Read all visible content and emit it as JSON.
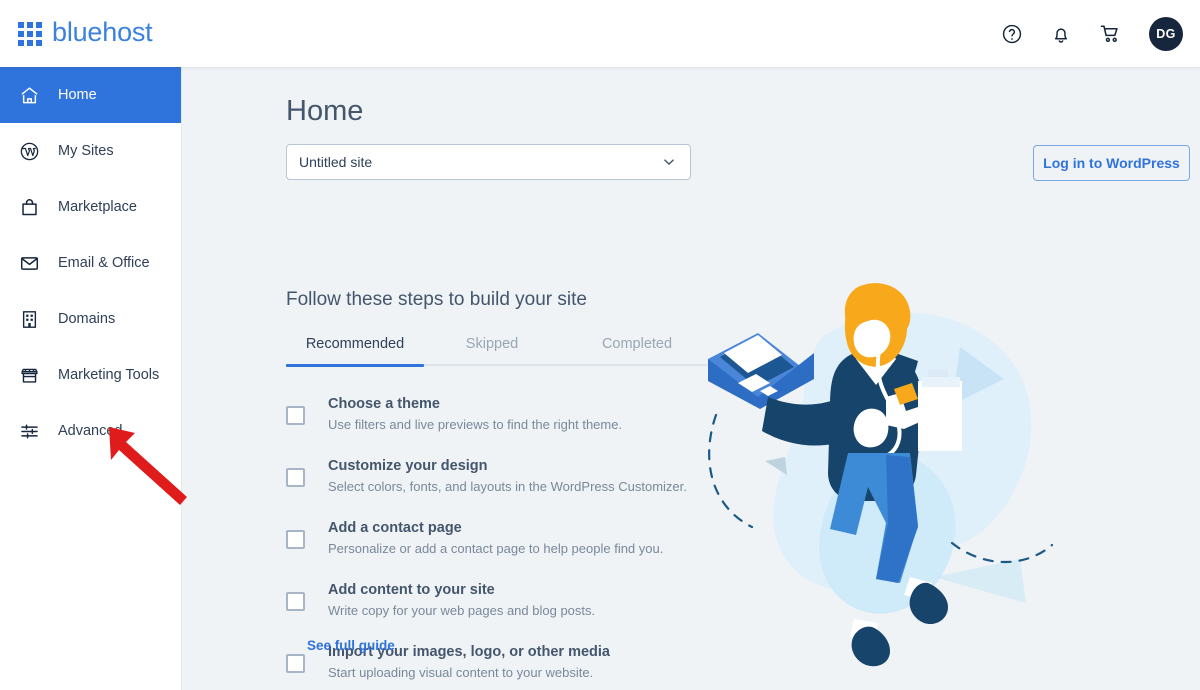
{
  "header": {
    "brand_name": "bluehost",
    "logo_icon": "grid-apps-icon",
    "actions": [
      {
        "name": "help-icon",
        "label": "Help"
      },
      {
        "name": "notifications-icon",
        "label": "Notifications"
      },
      {
        "name": "cart-icon",
        "label": "Cart"
      }
    ],
    "avatar_initials": "DG"
  },
  "sidebar": {
    "items": [
      {
        "label": "Home",
        "icon": "home-icon",
        "active": true
      },
      {
        "label": "My Sites",
        "icon": "wordpress-icon",
        "active": false
      },
      {
        "label": "Marketplace",
        "icon": "shopping-bag-icon",
        "active": false
      },
      {
        "label": "Email & Office",
        "icon": "envelope-icon",
        "active": false
      },
      {
        "label": "Domains",
        "icon": "building-icon",
        "active": false
      },
      {
        "label": "Marketing Tools",
        "icon": "storefront-icon",
        "active": false
      },
      {
        "label": "Advanced",
        "icon": "sliders-icon",
        "active": false
      }
    ]
  },
  "main": {
    "page_title": "Home",
    "site_selector": {
      "selected": "Untitled site",
      "chevron_icon": "chevron-down-icon"
    },
    "wordpress_button": "Log in to WordPress",
    "steps_heading": "Follow these steps to build your site",
    "tabs": [
      {
        "label": "Recommended",
        "active": true
      },
      {
        "label": "Skipped",
        "active": false
      },
      {
        "label": "Completed",
        "active": false
      }
    ],
    "checklist": [
      {
        "title": "Choose a theme",
        "desc": "Use filters and live previews to find the right theme.",
        "checked": false
      },
      {
        "title": "Customize your design",
        "desc": "Select colors, fonts, and layouts in the WordPress Customizer.",
        "checked": false
      },
      {
        "title": "Add a contact page",
        "desc": "Personalize or add a contact page to help people find you.",
        "checked": false
      },
      {
        "title": "Add content to your site",
        "desc": "Write copy for your web pages and blog posts.",
        "checked": false
      },
      {
        "title": "Import your images, logo, or other media",
        "desc": "Start uploading visual content to your website.",
        "checked": false
      }
    ],
    "see_full_guide": "See full guide",
    "illustration": "person-with-laptop-illustration"
  },
  "annotation": {
    "arrow": "red-arrow-pointing-to-advanced",
    "color": "#e01b1b"
  },
  "colors": {
    "brand_blue": "#2f73dd",
    "page_bg": "#eff3f6",
    "sidebar_bg": "#ffffff",
    "text_dark": "#44566c",
    "text_muted": "#7a889a",
    "avatar_bg": "#16263c",
    "annotation_red": "#e01b1b"
  }
}
